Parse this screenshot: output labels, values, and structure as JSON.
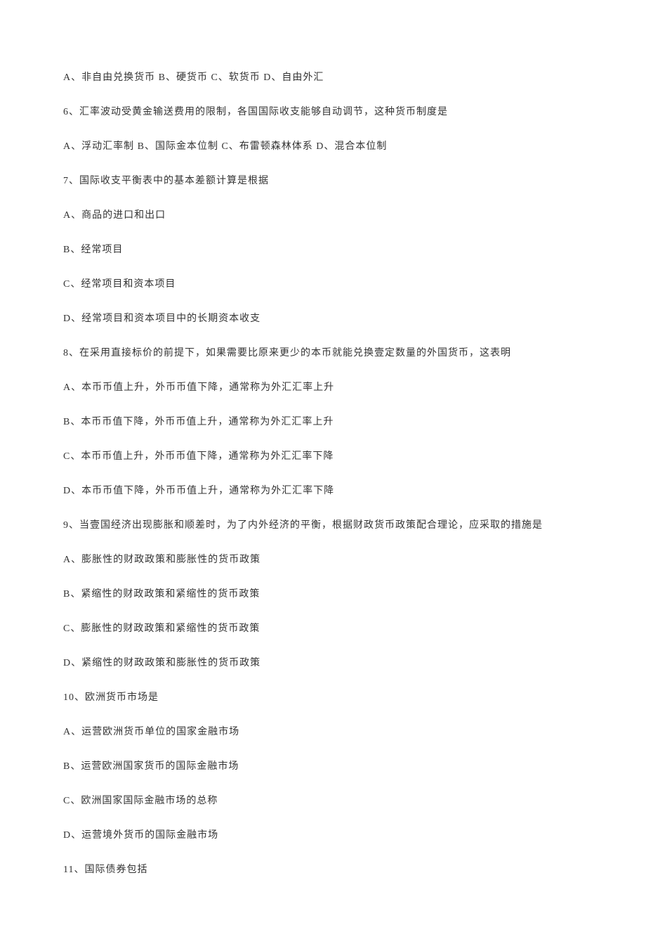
{
  "lines": [
    "A、非自由兑换货币 B、硬货币 C、软货币 D、自由外汇",
    "6、汇率波动受黄金输送费用的限制，各国国际收支能够自动调节，这种货币制度是",
    "A、浮动汇率制 B、国际金本位制 C、布雷顿森林体系 D、混合本位制",
    "7、国际收支平衡表中的基本差额计算是根据",
    "A、商品的进口和出口",
    "B、经常项目",
    "C、经常项目和资本项目",
    "D、经常项目和资本项目中的长期资本收支",
    "8、在采用直接标价的前提下，如果需要比原来更少的本币就能兑换壹定数量的外国货币，这表明",
    "A、本币币值上升，外币币值下降，通常称为外汇汇率上升",
    "B、本币币值下降，外币币值上升，通常称为外汇汇率上升",
    "C、本币币值上升，外币币值下降，通常称为外汇汇率下降",
    "D、本币币值下降，外币币值上升，通常称为外汇汇率下降",
    "9、当壹国经济出现膨胀和顺差时，为了内外经济的平衡，根据财政货币政策配合理论，应采取的措施是",
    "A、膨胀性的财政政策和膨胀性的货币政策",
    "B、紧缩性的财政政策和紧缩性的货币政策",
    "C、膨胀性的财政政策和紧缩性的货币政策",
    "D、紧缩性的财政政策和膨胀性的货币政策",
    "10、欧洲货币市场是",
    "A、运营欧洲货币单位的国家金融市场",
    "B、运营欧洲国家货币的国际金融市场",
    "C、欧洲国家国际金融市场的总称",
    "D、运营境外货币的国际金融市场",
    "11、国际债券包括"
  ]
}
